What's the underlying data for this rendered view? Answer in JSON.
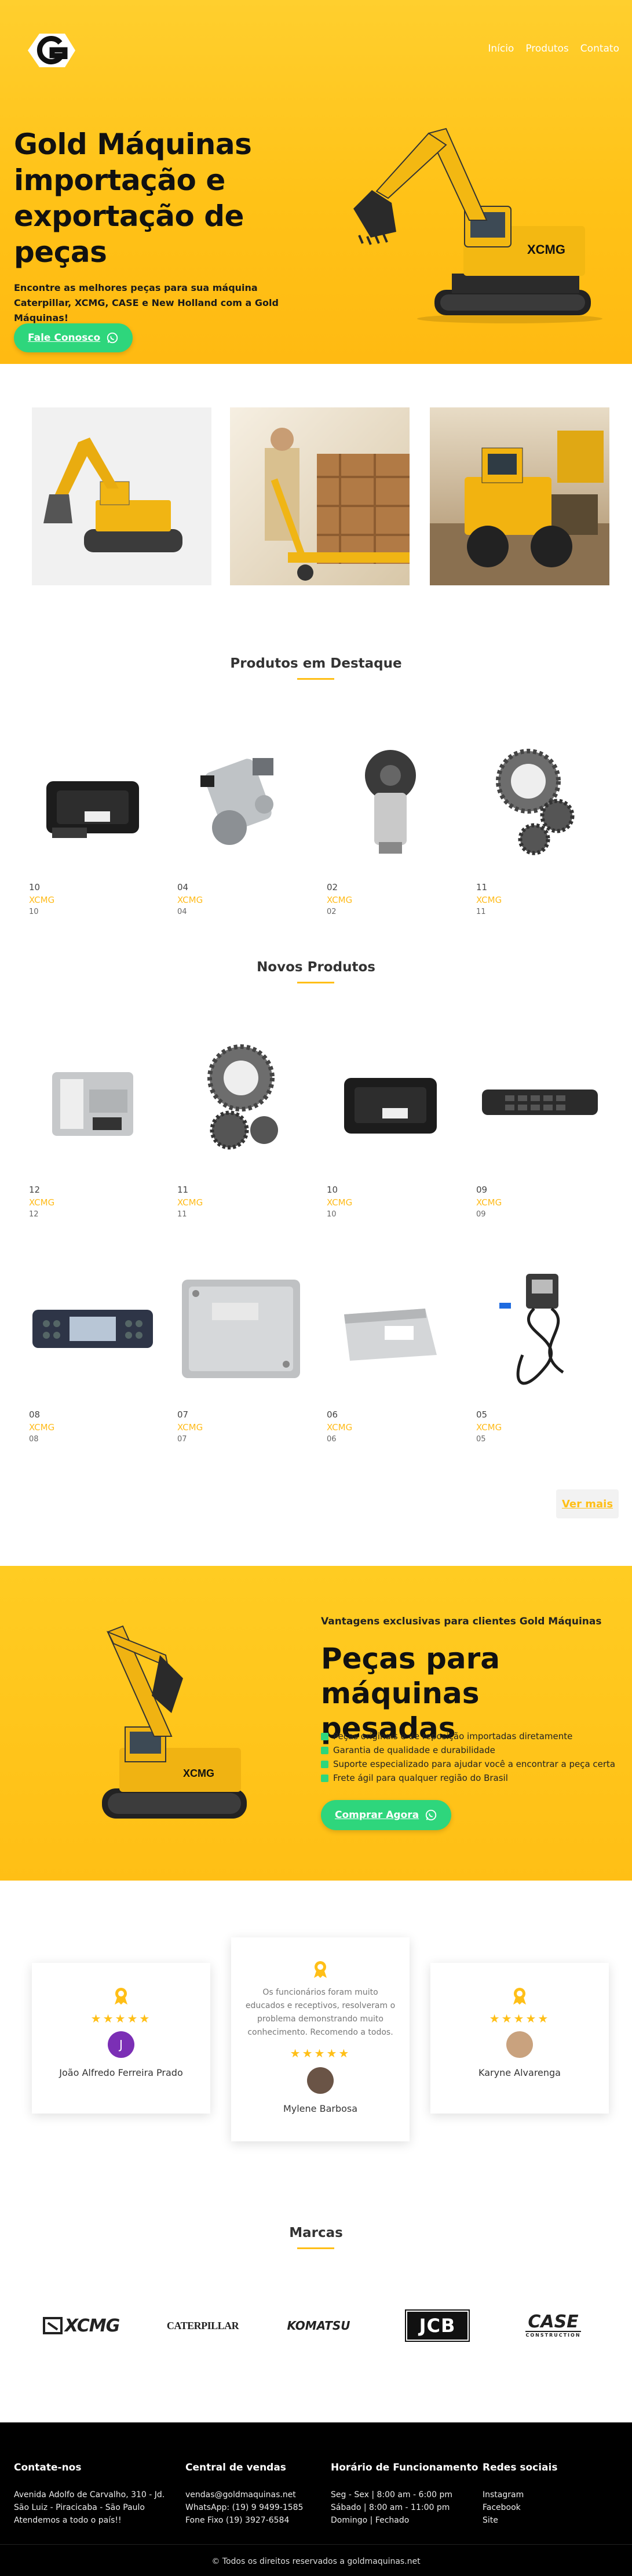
{
  "nav": {
    "items": [
      "Início",
      "Produtos",
      "Contato"
    ]
  },
  "hero": {
    "title": "Gold Máquinas importação e exportação de peças",
    "subtitle": "Encontre as melhores peças para sua máquina Caterpillar, XCMG, CASE e New Holland com a Gold Máquinas!",
    "cta": "Fale Conosco",
    "excavator_brand": "XCMG"
  },
  "featured": {
    "title": "Produtos em Destaque",
    "products": [
      {
        "code": "10",
        "brand": "XCMG",
        "code2": "10",
        "icon": "ecu-module-black"
      },
      {
        "code": "04",
        "brand": "XCMG",
        "code2": "04",
        "icon": "fuel-injection-pump"
      },
      {
        "code": "02",
        "brand": "XCMG",
        "code2": "02",
        "icon": "hydraulic-motor"
      },
      {
        "code": "11",
        "brand": "XCMG",
        "code2": "11",
        "icon": "planetary-gear"
      }
    ]
  },
  "new": {
    "title": "Novos Produtos",
    "products": [
      {
        "code": "12",
        "brand": "XCMG",
        "code2": "12",
        "icon": "ecu-module-silver"
      },
      {
        "code": "11",
        "brand": "XCMG",
        "code2": "11",
        "icon": "planetary-gear"
      },
      {
        "code": "10",
        "brand": "XCMG",
        "code2": "10",
        "icon": "ecu-module-black"
      },
      {
        "code": "09",
        "brand": "XCMG",
        "code2": "09",
        "icon": "switch-panel"
      },
      {
        "code": "08",
        "brand": "XCMG",
        "code2": "08",
        "icon": "display-monitor"
      },
      {
        "code": "07",
        "brand": "XCMG",
        "code2": "07",
        "icon": "engine-controller"
      },
      {
        "code": "06",
        "brand": "XCMG",
        "code2": "06",
        "icon": "control-unit"
      },
      {
        "code": "05",
        "brand": "XCMG",
        "code2": "05",
        "icon": "wiring-harness"
      }
    ],
    "more": "Ver mais"
  },
  "promo": {
    "kicker": "Vantagens exclusivas para clientes Gold Máquinas",
    "title": "Peças para máquinas pesadas",
    "bullets": [
      "Peças originais e de reposição importadas diretamente",
      "Garantia de qualidade e durabilidade",
      "Suporte especializado para ajudar você a encontrar a peça certa",
      "Frete ágil para qualquer região do Brasil"
    ],
    "cta": "Comprar Agora",
    "excavator_brand": "XCMG"
  },
  "testimonials": [
    {
      "name": "João Alfredo Ferreira Prado",
      "stars": "★★★★★",
      "initial": "J",
      "quote": ""
    },
    {
      "name": "Mylene Barbosa",
      "stars": "★★★★★",
      "initial": "",
      "quote": "Os funcionários foram muito educados e receptivos, resolveram o problema demonstrando muito conhecimento. Recomendo a todos."
    },
    {
      "name": "Karyne Alvarenga",
      "stars": "★★★★★",
      "initial": "",
      "quote": ""
    }
  ],
  "brands": {
    "title": "Marcas",
    "logos": [
      "XCMG",
      "CATERPILLAR",
      "KOMATSU",
      "JCB",
      "CASE"
    ],
    "case_sub": "CONSTRUCTION"
  },
  "footer": {
    "contact": {
      "title": "Contate-nos",
      "lines": [
        "Avenida Adolfo de Carvalho, 310 - Jd.",
        "São Luiz - Piracicaba - São Paulo",
        "Atendemos a todo o país!!"
      ]
    },
    "sales": {
      "title": "Central de vendas",
      "lines": [
        "vendas@goldmaquinas.net",
        "WhatsApp: (19) 9 9499-1585",
        "Fone Fixo (19) 3927-6584"
      ]
    },
    "hours": {
      "title": "Horário de Funcionamento",
      "lines": [
        "Seg - Sex | 8:00 am - 6:00 pm",
        "Sábado | 8:00 am - 11:00 pm",
        "Domingo | Fechado"
      ]
    },
    "social": {
      "title": "Redes sociais",
      "lines": [
        "Instagram",
        "Facebook",
        "Site"
      ]
    },
    "copyright": "© Todos os direitos reservados a goldmaquinas.net"
  },
  "colors": {
    "yellow": "#ffc217",
    "green": "#2ed67c",
    "accent": "#ffbb1a",
    "footer_bg": "#000000"
  }
}
